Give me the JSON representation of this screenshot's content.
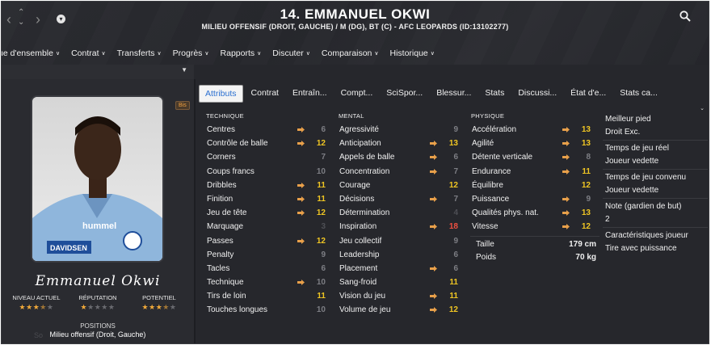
{
  "header": {
    "title": "14. EMMANUEL OKWI",
    "subtitle": "MILIEU OFFENSIF (DROIT, GAUCHE) / M (DG), BT (C) - AFC LEOPARDS (ID:13102277)"
  },
  "menu": [
    {
      "label": "ue d'ensemble"
    },
    {
      "label": "Contrat"
    },
    {
      "label": "Transferts"
    },
    {
      "label": "Progrès"
    },
    {
      "label": "Rapports"
    },
    {
      "label": "Discuter"
    },
    {
      "label": "Comparaison"
    },
    {
      "label": "Historique"
    }
  ],
  "tabs": [
    {
      "label": "Attributs",
      "active": true
    },
    {
      "label": "Contrat"
    },
    {
      "label": "Entraîn..."
    },
    {
      "label": "Compt..."
    },
    {
      "label": "SciSpor..."
    },
    {
      "label": "Blessur..."
    },
    {
      "label": "Stats"
    },
    {
      "label": "Discussi..."
    },
    {
      "label": "État d'e..."
    },
    {
      "label": "Stats ca..."
    }
  ],
  "player": {
    "badge": "Bis",
    "signature": "Emmanuel Okwi",
    "ratings": [
      {
        "label": "NIVEAU ACTUEL",
        "stars": 3.5
      },
      {
        "label": "RÉPUTATION",
        "stars": 1
      },
      {
        "label": "POTENTIEL",
        "stars": 3.5
      }
    ],
    "positions_label": "POSITIONS",
    "positions_value": "Milieu offensif (Droit, Gauche)",
    "ghost_text": "So"
  },
  "columns": [
    {
      "heading": "TECHNIQUE",
      "rows": [
        {
          "label": "Centres",
          "value": "6",
          "color": "gray",
          "arrow": true
        },
        {
          "label": "Contrôle de balle",
          "value": "12",
          "color": "yellow",
          "arrow": true
        },
        {
          "label": "Corners",
          "value": "7",
          "color": "gray",
          "arrow": false
        },
        {
          "label": "Coups francs",
          "value": "10",
          "color": "gray",
          "arrow": false
        },
        {
          "label": "Dribbles",
          "value": "11",
          "color": "yellow",
          "arrow": true
        },
        {
          "label": "Finition",
          "value": "11",
          "color": "yellow",
          "arrow": true
        },
        {
          "label": "Jeu de tête",
          "value": "12",
          "color": "yellow",
          "arrow": true
        },
        {
          "label": "Marquage",
          "value": "3",
          "color": "dim",
          "arrow": false
        },
        {
          "label": "Passes",
          "value": "12",
          "color": "yellow",
          "arrow": true
        },
        {
          "label": "Penalty",
          "value": "9",
          "color": "gray",
          "arrow": false
        },
        {
          "label": "Tacles",
          "value": "6",
          "color": "gray",
          "arrow": false
        },
        {
          "label": "Technique",
          "value": "10",
          "color": "gray",
          "arrow": true
        },
        {
          "label": "Tirs de loin",
          "value": "11",
          "color": "yellow",
          "arrow": false
        },
        {
          "label": "Touches longues",
          "value": "10",
          "color": "gray",
          "arrow": false
        }
      ]
    },
    {
      "heading": "MENTAL",
      "rows": [
        {
          "label": "Agressivité",
          "value": "9",
          "color": "gray",
          "arrow": false
        },
        {
          "label": "Anticipation",
          "value": "13",
          "color": "yellow",
          "arrow": true
        },
        {
          "label": "Appels de balle",
          "value": "6",
          "color": "gray",
          "arrow": true
        },
        {
          "label": "Concentration",
          "value": "7",
          "color": "gray",
          "arrow": true
        },
        {
          "label": "Courage",
          "value": "12",
          "color": "yellow",
          "arrow": false
        },
        {
          "label": "Décisions",
          "value": "7",
          "color": "gray",
          "arrow": true
        },
        {
          "label": "Détermination",
          "value": "4",
          "color": "dim",
          "arrow": false
        },
        {
          "label": "Inspiration",
          "value": "18",
          "color": "red",
          "arrow": true
        },
        {
          "label": "Jeu collectif",
          "value": "9",
          "color": "gray",
          "arrow": false
        },
        {
          "label": "Leadership",
          "value": "6",
          "color": "gray",
          "arrow": false
        },
        {
          "label": "Placement",
          "value": "6",
          "color": "gray",
          "arrow": true
        },
        {
          "label": "Sang-froid",
          "value": "11",
          "color": "yellow",
          "arrow": false
        },
        {
          "label": "Vision du jeu",
          "value": "11",
          "color": "yellow",
          "arrow": true
        },
        {
          "label": "Volume de jeu",
          "value": "12",
          "color": "yellow",
          "arrow": true
        }
      ]
    },
    {
      "heading": "PHYSIQUE",
      "rows": [
        {
          "label": "Accélération",
          "value": "13",
          "color": "yellow",
          "arrow": true
        },
        {
          "label": "Agilité",
          "value": "13",
          "color": "yellow",
          "arrow": true
        },
        {
          "label": "Détente verticale",
          "value": "8",
          "color": "gray",
          "arrow": true
        },
        {
          "label": "Endurance",
          "value": "11",
          "color": "yellow",
          "arrow": true
        },
        {
          "label": "Équilibre",
          "value": "12",
          "color": "yellow",
          "arrow": false
        },
        {
          "label": "Puissance",
          "value": "9",
          "color": "gray",
          "arrow": true
        },
        {
          "label": "Qualités phys. nat.",
          "value": "13",
          "color": "yellow",
          "arrow": true
        },
        {
          "label": "Vitesse",
          "value": "12",
          "color": "yellow",
          "arrow": true
        }
      ]
    }
  ],
  "info": [
    {
      "label": "Taille",
      "value": "179 cm"
    },
    {
      "label": "Poids",
      "value": "70 kg"
    }
  ],
  "right_panel": [
    {
      "title": "Meilleur pied",
      "value": "Droit Exc."
    },
    {
      "title": "Temps de jeu réel",
      "value": "Joueur vedette"
    },
    {
      "title": "Temps de jeu convenu",
      "value": "Joueur vedette"
    },
    {
      "title": "Note (gardien de but)",
      "value": "2"
    },
    {
      "title": "Caractéristiques joueur",
      "value": "Tire avec puissance"
    }
  ],
  "colors": {
    "yellow": "#f0c623",
    "gray": "#7d7e84",
    "red": "#f05040",
    "dim": "#4e4f55",
    "arrow": "#e8a04a",
    "active_tab_text": "#2a6fd0"
  }
}
